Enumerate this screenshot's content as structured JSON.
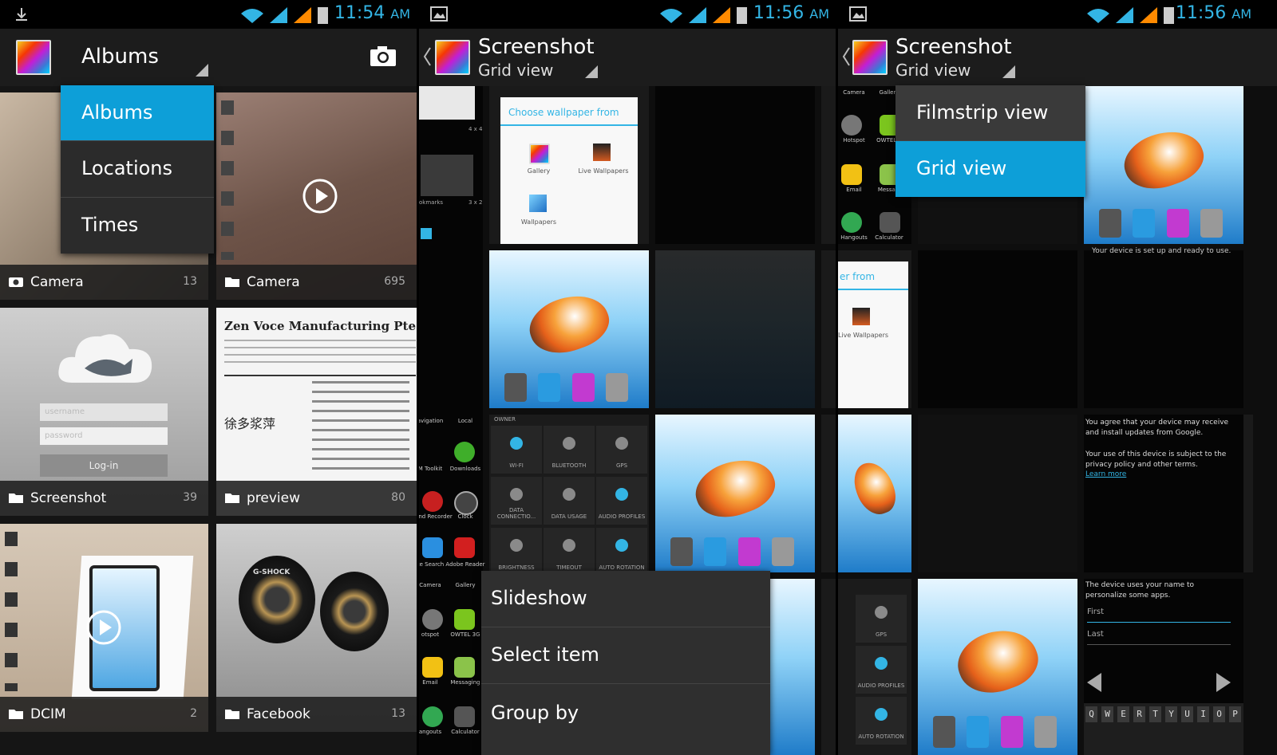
{
  "panels": [
    {
      "status": {
        "time": "11:54",
        "ampm": "AM"
      },
      "actionbar": {
        "title": "Albums"
      },
      "menu": {
        "items": [
          "Albums",
          "Locations",
          "Times"
        ],
        "selected": 0
      },
      "albums": [
        {
          "name": "Camera",
          "count": "13",
          "icon": "camera-icon"
        },
        {
          "name": "Camera",
          "count": "695",
          "icon": "folder-icon"
        },
        {
          "name": "Screenshot",
          "count": "39",
          "icon": "folder-icon"
        },
        {
          "name": "preview",
          "count": "80",
          "icon": "folder-icon"
        },
        {
          "name": "DCIM",
          "count": "2",
          "icon": "folder-icon"
        },
        {
          "name": "Facebook",
          "count": "13",
          "icon": "folder-icon"
        }
      ],
      "fishcloud": {
        "username": "username",
        "password": "password",
        "login": "Log-in"
      },
      "doc": {
        "heading": "Zen Voce Manufacturing Pte L",
        "cn": "徐多浆萍"
      },
      "watch_brand": "G-SHOCK"
    },
    {
      "status": {
        "time": "11:56",
        "ampm": "AM"
      },
      "actionbar": {
        "title": "Screenshot",
        "subtitle": "Grid view"
      },
      "wallpaper_dialog": {
        "title": "Choose wallpaper from",
        "options": [
          "Gallery",
          "Live Wallpapers",
          "Wallpapers"
        ]
      },
      "quick_settings": {
        "owner": "OWNER",
        "tiles": [
          "WI-FI",
          "BLUETOOTH",
          "GPS",
          "DATA CONNECTIO...",
          "DATA USAGE",
          "AUDIO PROFILES",
          "BRIGHTNESS",
          "TIMEOUT",
          "AUTO ROTATION"
        ]
      },
      "app_labels": [
        "avigation",
        "Local",
        "M Toolkit",
        "Downloads",
        "Sound Recorder",
        "Clock",
        "ce Search",
        "Adobe Reader",
        "Camera",
        "Gallery",
        "otspot",
        "OWTEL 3G",
        "Email",
        "Messaging",
        "angouts",
        "Calculator"
      ],
      "strip_labels": {
        "kbd_tag": "4 x 4",
        "kbd_tag2": "3 x 2",
        "bookmarks": "okmarks"
      },
      "overflow_menu": {
        "items": [
          "Slideshow",
          "Select item",
          "Group by"
        ]
      }
    },
    {
      "status": {
        "time": "11:56",
        "ampm": "AM"
      },
      "actionbar": {
        "title": "Screenshot",
        "subtitle": "Grid view"
      },
      "menu": {
        "items": [
          "Filmstrip view",
          "Grid view"
        ],
        "selected": 1
      },
      "app_labels": [
        "Camera",
        "Gallery",
        "Hotspot",
        "OWTEL 3",
        "Email",
        "Messagi",
        "Hangouts",
        "Calculator"
      ],
      "partial_dialog": {
        "title": "er from",
        "option": "Live Wallpapers"
      },
      "setup_text": {
        "ready": "Your device is set up and ready to use.",
        "agree": "You agree that your device may receive and install updates from Google.",
        "privacy": "Your use of this device is subject to the privacy policy and other terms.",
        "learn": "Learn more",
        "name_hint": "The device uses your name to personalize some apps.",
        "first": "First",
        "last": "Last"
      },
      "qs_labels": [
        "GPS",
        "AUDIO PROFILES",
        "AUTO ROTATION"
      ],
      "keyboard_row": [
        "Q",
        "W",
        "E",
        "R",
        "T",
        "Y",
        "U",
        "I",
        "O",
        "P"
      ]
    }
  ],
  "colors": {
    "accent": "#33b5e5",
    "selected_menu": "#0d9fd8",
    "status_icons": "#33b5e5",
    "signal_orange": "#ff8a00"
  }
}
